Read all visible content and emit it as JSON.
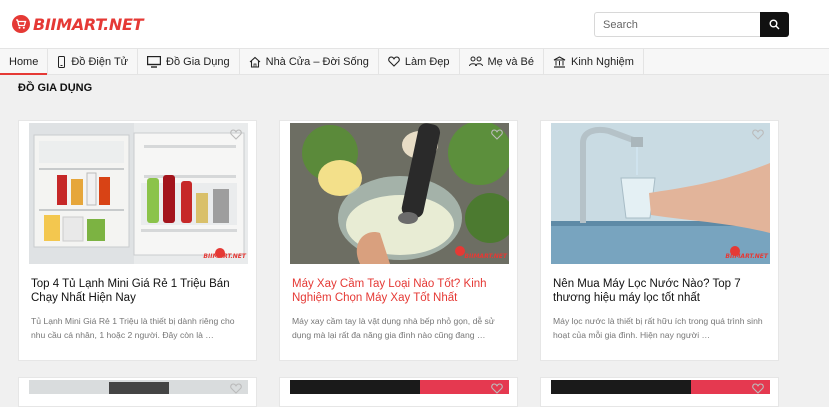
{
  "brand": {
    "name": "BIIMART.NET",
    "color": "#e53935"
  },
  "search": {
    "placeholder": "Search"
  },
  "nav": [
    {
      "label": "Home",
      "icon": ""
    },
    {
      "label": "Đồ Điện Tử",
      "icon": "phone-icon"
    },
    {
      "label": "Đồ Gia Dụng",
      "icon": "monitor-icon"
    },
    {
      "label": "Nhà Cửa – Đời Sống",
      "icon": "home-icon"
    },
    {
      "label": "Làm Đẹp",
      "icon": "heart-icon"
    },
    {
      "label": "Mẹ và Bé",
      "icon": "people-icon"
    },
    {
      "label": "Kinh Nghiệm",
      "icon": "bank-icon"
    }
  ],
  "section": {
    "title": "ĐỒ GIA DỤNG"
  },
  "cards": [
    {
      "title": "Top 4 Tủ Lạnh Mini Giá Rẻ 1 Triệu Bán Chạy Nhất Hiện Nay",
      "excerpt": "Tủ Lạnh Mini Giá Rẻ 1 Triệu là thiết bị dành riêng cho nhu cầu cá nhân, 1 hoặc 2 người. Đây còn là …",
      "watermark": "BIIMART.NET"
    },
    {
      "title": "Máy Xay Cầm Tay Loại Nào Tốt? Kinh Nghiệm Chọn Máy Xay Tốt Nhất",
      "excerpt": "Máy xay cầm tay là vật dụng nhà bếp nhỏ gọn, dễ sử dụng mà lại rất đa năng gia đình nào cũng đang …",
      "watermark": "BIIMART.NET"
    },
    {
      "title": "Nên Mua Máy Lọc Nước Nào? Top 7 thương hiệu máy lọc tốt nhất",
      "excerpt": "Máy lọc nước là thiết bị rất hữu ích trong quá trình sinh hoạt của mỗi gia đình. Hiện nay người …",
      "watermark": "BIIMART.NET"
    }
  ]
}
